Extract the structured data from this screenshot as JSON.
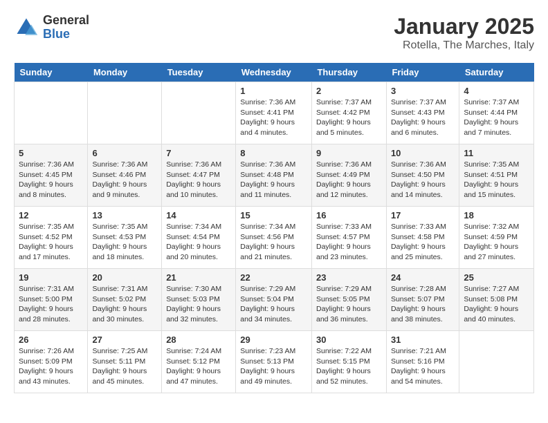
{
  "logo": {
    "general": "General",
    "blue": "Blue"
  },
  "title": {
    "month": "January 2025",
    "location": "Rotella, The Marches, Italy"
  },
  "headers": [
    "Sunday",
    "Monday",
    "Tuesday",
    "Wednesday",
    "Thursday",
    "Friday",
    "Saturday"
  ],
  "weeks": [
    [
      {
        "day": "",
        "info": ""
      },
      {
        "day": "",
        "info": ""
      },
      {
        "day": "",
        "info": ""
      },
      {
        "day": "1",
        "info": "Sunrise: 7:36 AM\nSunset: 4:41 PM\nDaylight: 9 hours\nand 4 minutes."
      },
      {
        "day": "2",
        "info": "Sunrise: 7:37 AM\nSunset: 4:42 PM\nDaylight: 9 hours\nand 5 minutes."
      },
      {
        "day": "3",
        "info": "Sunrise: 7:37 AM\nSunset: 4:43 PM\nDaylight: 9 hours\nand 6 minutes."
      },
      {
        "day": "4",
        "info": "Sunrise: 7:37 AM\nSunset: 4:44 PM\nDaylight: 9 hours\nand 7 minutes."
      }
    ],
    [
      {
        "day": "5",
        "info": "Sunrise: 7:36 AM\nSunset: 4:45 PM\nDaylight: 9 hours\nand 8 minutes."
      },
      {
        "day": "6",
        "info": "Sunrise: 7:36 AM\nSunset: 4:46 PM\nDaylight: 9 hours\nand 9 minutes."
      },
      {
        "day": "7",
        "info": "Sunrise: 7:36 AM\nSunset: 4:47 PM\nDaylight: 9 hours\nand 10 minutes."
      },
      {
        "day": "8",
        "info": "Sunrise: 7:36 AM\nSunset: 4:48 PM\nDaylight: 9 hours\nand 11 minutes."
      },
      {
        "day": "9",
        "info": "Sunrise: 7:36 AM\nSunset: 4:49 PM\nDaylight: 9 hours\nand 12 minutes."
      },
      {
        "day": "10",
        "info": "Sunrise: 7:36 AM\nSunset: 4:50 PM\nDaylight: 9 hours\nand 14 minutes."
      },
      {
        "day": "11",
        "info": "Sunrise: 7:35 AM\nSunset: 4:51 PM\nDaylight: 9 hours\nand 15 minutes."
      }
    ],
    [
      {
        "day": "12",
        "info": "Sunrise: 7:35 AM\nSunset: 4:52 PM\nDaylight: 9 hours\nand 17 minutes."
      },
      {
        "day": "13",
        "info": "Sunrise: 7:35 AM\nSunset: 4:53 PM\nDaylight: 9 hours\nand 18 minutes."
      },
      {
        "day": "14",
        "info": "Sunrise: 7:34 AM\nSunset: 4:54 PM\nDaylight: 9 hours\nand 20 minutes."
      },
      {
        "day": "15",
        "info": "Sunrise: 7:34 AM\nSunset: 4:56 PM\nDaylight: 9 hours\nand 21 minutes."
      },
      {
        "day": "16",
        "info": "Sunrise: 7:33 AM\nSunset: 4:57 PM\nDaylight: 9 hours\nand 23 minutes."
      },
      {
        "day": "17",
        "info": "Sunrise: 7:33 AM\nSunset: 4:58 PM\nDaylight: 9 hours\nand 25 minutes."
      },
      {
        "day": "18",
        "info": "Sunrise: 7:32 AM\nSunset: 4:59 PM\nDaylight: 9 hours\nand 27 minutes."
      }
    ],
    [
      {
        "day": "19",
        "info": "Sunrise: 7:31 AM\nSunset: 5:00 PM\nDaylight: 9 hours\nand 28 minutes."
      },
      {
        "day": "20",
        "info": "Sunrise: 7:31 AM\nSunset: 5:02 PM\nDaylight: 9 hours\nand 30 minutes."
      },
      {
        "day": "21",
        "info": "Sunrise: 7:30 AM\nSunset: 5:03 PM\nDaylight: 9 hours\nand 32 minutes."
      },
      {
        "day": "22",
        "info": "Sunrise: 7:29 AM\nSunset: 5:04 PM\nDaylight: 9 hours\nand 34 minutes."
      },
      {
        "day": "23",
        "info": "Sunrise: 7:29 AM\nSunset: 5:05 PM\nDaylight: 9 hours\nand 36 minutes."
      },
      {
        "day": "24",
        "info": "Sunrise: 7:28 AM\nSunset: 5:07 PM\nDaylight: 9 hours\nand 38 minutes."
      },
      {
        "day": "25",
        "info": "Sunrise: 7:27 AM\nSunset: 5:08 PM\nDaylight: 9 hours\nand 40 minutes."
      }
    ],
    [
      {
        "day": "26",
        "info": "Sunrise: 7:26 AM\nSunset: 5:09 PM\nDaylight: 9 hours\nand 43 minutes."
      },
      {
        "day": "27",
        "info": "Sunrise: 7:25 AM\nSunset: 5:11 PM\nDaylight: 9 hours\nand 45 minutes."
      },
      {
        "day": "28",
        "info": "Sunrise: 7:24 AM\nSunset: 5:12 PM\nDaylight: 9 hours\nand 47 minutes."
      },
      {
        "day": "29",
        "info": "Sunrise: 7:23 AM\nSunset: 5:13 PM\nDaylight: 9 hours\nand 49 minutes."
      },
      {
        "day": "30",
        "info": "Sunrise: 7:22 AM\nSunset: 5:15 PM\nDaylight: 9 hours\nand 52 minutes."
      },
      {
        "day": "31",
        "info": "Sunrise: 7:21 AM\nSunset: 5:16 PM\nDaylight: 9 hours\nand 54 minutes."
      },
      {
        "day": "",
        "info": ""
      }
    ]
  ]
}
